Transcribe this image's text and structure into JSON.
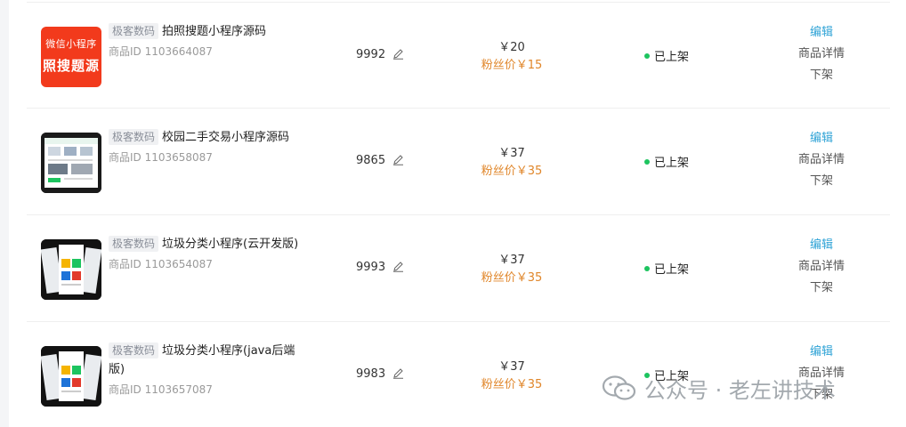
{
  "products": [
    {
      "thumb_type": "red",
      "thumb_line1": "微信小程序",
      "thumb_line2": "照搜题源",
      "tag": "极客数码",
      "title": "拍照搜题小程序源码",
      "product_id": "商品ID 1103664087",
      "stock": "9992",
      "price": "￥20",
      "fan_price": "粉丝价￥15",
      "status": "已上架",
      "op_edit": "编辑",
      "op_detail": "商品详情",
      "op_offshelf": "下架"
    },
    {
      "thumb_type": "screens",
      "tag": "极客数码",
      "title": "校园二手交易小程序源码",
      "product_id": "商品ID 1103658087",
      "stock": "9865",
      "price": "￥37",
      "fan_price": "粉丝价￥35",
      "status": "已上架",
      "op_edit": "编辑",
      "op_detail": "商品详情",
      "op_offshelf": "下架"
    },
    {
      "thumb_type": "dark",
      "tag": "极客数码",
      "title": "垃圾分类小程序(云开发版)",
      "product_id": "商品ID 1103654087",
      "stock": "9993",
      "price": "￥37",
      "fan_price": "粉丝价￥35",
      "status": "已上架",
      "op_edit": "编辑",
      "op_detail": "商品详情",
      "op_offshelf": "下架"
    },
    {
      "thumb_type": "dark",
      "tag": "极客数码",
      "title": "垃圾分类小程序(java后端版)",
      "product_id": "商品ID 1103657087",
      "stock": "9983",
      "price": "￥37",
      "fan_price": "粉丝价￥35",
      "status": "已上架",
      "op_edit": "编辑",
      "op_detail": "商品详情",
      "op_offshelf": "下架"
    }
  ],
  "watermark": {
    "text": "公众号 · 老左讲技术"
  },
  "colors": {
    "edit": "#2fa3d6",
    "fan_price": "#e0862a",
    "status_dot": "#1dc45f"
  }
}
